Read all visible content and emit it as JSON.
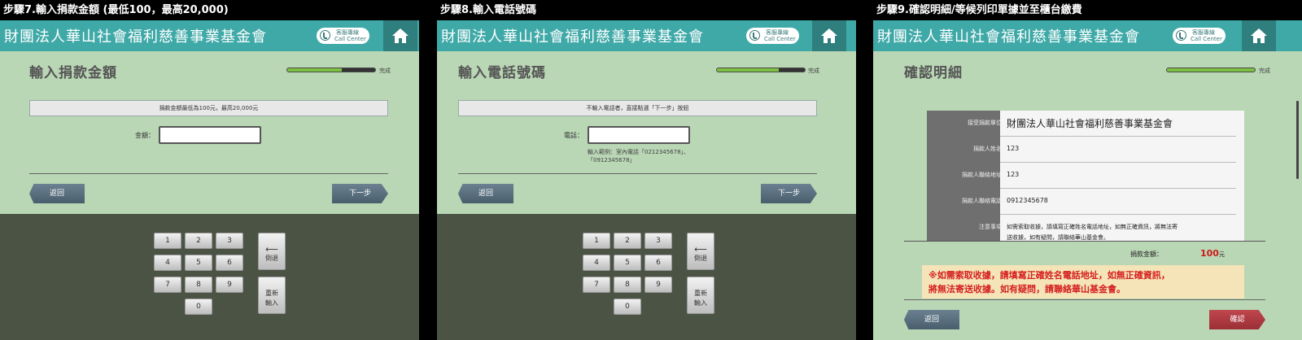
{
  "org_name": "財團法人華山社會福利慈善事業基金會",
  "call_center": {
    "line1": "客服專線",
    "line2": "Call Center"
  },
  "progress_label": "完成",
  "step7": {
    "caption": "步驟7.輸入捐款金額 (最低100，最高20,000)",
    "title": "輸入捐款金額",
    "progress": 0.62,
    "note": "捐款金額最低為100元，最高20,000元",
    "field_label": "金額：",
    "field_value": "",
    "back_label": "返回",
    "next_label": "下一步"
  },
  "step8": {
    "caption": "步驟8.輸入電話號碼",
    "title": "輸入電話號碼",
    "progress": 0.7,
    "note": "不輸入電話者，直接點選「下一步」按鈕",
    "field_label": "電話：",
    "field_value": "",
    "hint_line1": "輸入範例：室內電話「0212345678」、",
    "hint_line2": "「0912345678」",
    "back_label": "返回",
    "next_label": "下一步"
  },
  "keypad": {
    "keys": [
      "1",
      "2",
      "3",
      "4",
      "5",
      "6",
      "7",
      "8",
      "9",
      "0"
    ],
    "backspace_label": "倒退",
    "reset_line1": "重新",
    "reset_line2": "輸入"
  },
  "step9": {
    "caption": "步驟9.確認明細/等候列印單據並至櫃台繳費",
    "title": "確認明細",
    "progress": 1.0,
    "rows": [
      {
        "label": "接受捐款單位",
        "value": "財團法人華山社會福利慈善事業基金會"
      },
      {
        "label": "捐款人姓名",
        "value": "123"
      },
      {
        "label": "捐款人聯絡地址",
        "value": "123"
      },
      {
        "label": "捐款人聯絡電話",
        "value": "0912345678"
      },
      {
        "label": "注意事項",
        "value": "如需索取收據，請填寫正確姓名電話地址，如無正確資訊，將無法寄"
      },
      {
        "label": "",
        "value": "送收據，如有疑問，請聯絡華山基金會。"
      }
    ],
    "amount_label": "捐款金額：",
    "amount_value": "100",
    "amount_unit": "元",
    "warning_line1": "※如需索取收據，請填寫正確姓名電話地址，如無正確資訊，",
    "warning_line2": "將無法寄送收據。如有疑問，請聯絡華山基金會。",
    "back_label": "返回",
    "confirm_label": "確認"
  }
}
